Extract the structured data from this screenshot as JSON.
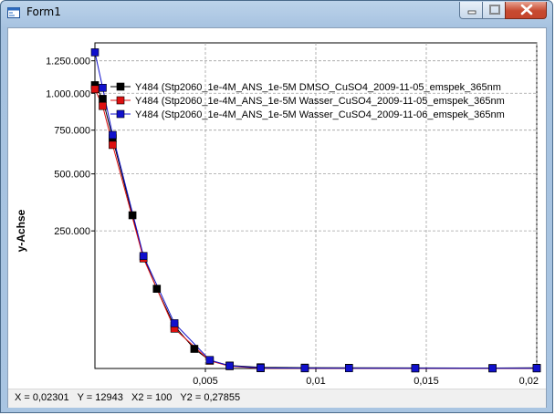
{
  "window": {
    "title": "Form1",
    "controls": {
      "minimize": "minimize",
      "maximize": "maximize",
      "close": "close"
    }
  },
  "status": {
    "text": "X = 0,02301   Y = 12943   X2 = 100   Y2 = 0,27855"
  },
  "chart_data": {
    "type": "line",
    "ylabel": "y-Achse",
    "xlabel": "",
    "x_scale": "linear",
    "y_scale": "sqrt",
    "xlim": [
      0,
      0.02
    ],
    "ylim": [
      0,
      1400000
    ],
    "grid": true,
    "legend_position": "top-right (inside plot)",
    "y_ticks": [
      {
        "value": 1250000,
        "label": "1.250.000"
      },
      {
        "value": 1000000,
        "label": "1.000.000"
      },
      {
        "value": 750000,
        "label": "750.000"
      },
      {
        "value": 500000,
        "label": "500.000"
      },
      {
        "value": 250000,
        "label": "250.000"
      }
    ],
    "x_ticks": [
      {
        "value": 0.005,
        "label": "0,005"
      },
      {
        "value": 0.01,
        "label": "0,01"
      },
      {
        "value": 0.015,
        "label": "0,015"
      },
      {
        "value": 0.02,
        "label": "0,02"
      }
    ],
    "series": [
      {
        "name": "Y484 (Stp2060_1e-4M_ANS_1e-5M DMSO_CuSO4_2009-11-05_emspek_365nm",
        "color": "#000000",
        "points": [
          {
            "x": 0,
            "y": 1060000
          },
          {
            "x": 0.00035,
            "y": 960000
          },
          {
            "x": 0.0008,
            "y": 700000
          },
          {
            "x": 0.0017,
            "y": 310000
          },
          {
            "x": 0.0022,
            "y": 165000
          },
          {
            "x": 0.0028,
            "y": 84000
          },
          {
            "x": 0.0036,
            "y": 24000
          },
          {
            "x": 0.0045,
            "y": 5100
          },
          {
            "x": 0.0052,
            "y": 850
          },
          {
            "x": 0.0061,
            "y": 110
          },
          {
            "x": 0.0075,
            "y": 20
          },
          {
            "x": 0.0095,
            "y": 8
          },
          {
            "x": 0.0115,
            "y": 5.5
          },
          {
            "x": 0.0145,
            "y": 4
          },
          {
            "x": 0.018,
            "y": 2.7
          },
          {
            "x": 0.02,
            "y": 5
          }
        ]
      },
      {
        "name": "Y484 (Stp2060_1e-4M_ANS_1e-5M Wasser_CuSO4_2009-11-05_emspek_365nm",
        "color": "#dd1010",
        "points": [
          {
            "x": 0,
            "y": 1030000
          },
          {
            "x": 0.00035,
            "y": 910000
          },
          {
            "x": 0.0008,
            "y": 660000
          },
          {
            "x": 0.0022,
            "y": 160000
          },
          {
            "x": 0.0036,
            "y": 21000
          },
          {
            "x": 0.0052,
            "y": 800
          },
          {
            "x": 0.0061,
            "y": 70
          },
          {
            "x": 0.0075,
            "y": 1
          },
          {
            "x": 0.0095,
            "y": 0.5
          },
          {
            "x": 0.0145,
            "y": 0.2
          },
          {
            "x": 0.018,
            "y": 0.1
          },
          {
            "x": 0.02,
            "y": 0.1
          }
        ]
      },
      {
        "name": "Y484 (Stp2060_1e-4M_ANS_1e-5M Wasser_CuSO4_2009-11-06_emspek_365nm",
        "color": "#1010cc",
        "points": [
          {
            "x": 0,
            "y": 1320000
          },
          {
            "x": 0.00035,
            "y": 1040000
          },
          {
            "x": 0.0008,
            "y": 720000
          },
          {
            "x": 0.0022,
            "y": 167000
          },
          {
            "x": 0.0036,
            "y": 27000
          },
          {
            "x": 0.0052,
            "y": 950
          },
          {
            "x": 0.0061,
            "y": 90
          },
          {
            "x": 0.0075,
            "y": 4
          },
          {
            "x": 0.0095,
            "y": 1.5
          },
          {
            "x": 0.0115,
            "y": 1
          },
          {
            "x": 0.0145,
            "y": 0.5
          },
          {
            "x": 0.018,
            "y": 0.5
          },
          {
            "x": 0.02,
            "y": 1
          }
        ]
      }
    ]
  }
}
